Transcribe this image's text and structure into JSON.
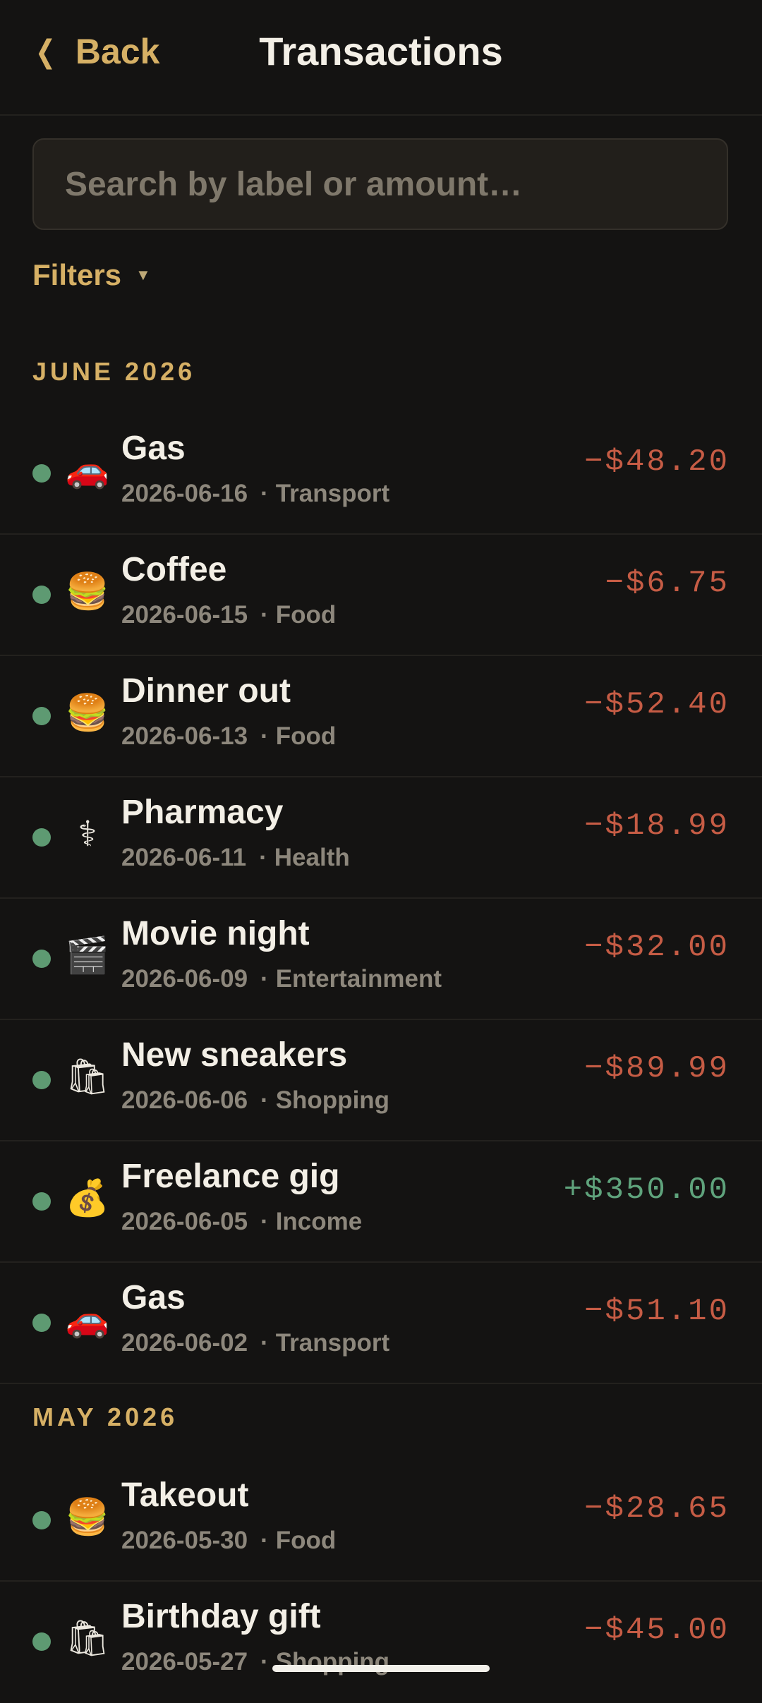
{
  "header": {
    "back_label": "Back",
    "title": "Transactions"
  },
  "search": {
    "placeholder": "Search by label or amount…",
    "value": ""
  },
  "filters": {
    "label": "Filters"
  },
  "colors": {
    "accent": "#d6b065",
    "negative": "#c65c45",
    "positive": "#5fa37c",
    "status_dot": "#5e9a72"
  },
  "sections": [
    {
      "label": "JUNE 2026",
      "transactions": [
        {
          "icon": "🚗",
          "icon_name": "car-icon",
          "label": "Gas",
          "date": "2026-06-16",
          "category": "Transport",
          "amount": "−$48.20",
          "type": "neg"
        },
        {
          "icon": "🍔",
          "icon_name": "burger-icon",
          "label": "Coffee",
          "date": "2026-06-15",
          "category": "Food",
          "amount": "−$6.75",
          "type": "neg"
        },
        {
          "icon": "🍔",
          "icon_name": "burger-icon",
          "label": "Dinner out",
          "date": "2026-06-13",
          "category": "Food",
          "amount": "−$52.40",
          "type": "neg"
        },
        {
          "icon": "⚕",
          "icon_name": "medical-icon",
          "label": "Pharmacy",
          "date": "2026-06-11",
          "category": "Health",
          "amount": "−$18.99",
          "type": "neg"
        },
        {
          "icon": "🎬",
          "icon_name": "clapperboard-icon",
          "label": "Movie night",
          "date": "2026-06-09",
          "category": "Entertainment",
          "amount": "−$32.00",
          "type": "neg"
        },
        {
          "icon": "🛍",
          "icon_name": "shopping-bags-icon",
          "label": "New sneakers",
          "date": "2026-06-06",
          "category": "Shopping",
          "amount": "−$89.99",
          "type": "neg"
        },
        {
          "icon": "💰",
          "icon_name": "money-bag-icon",
          "label": "Freelance gig",
          "date": "2026-06-05",
          "category": "Income",
          "amount": "+$350.00",
          "type": "pos"
        },
        {
          "icon": "🚗",
          "icon_name": "car-icon",
          "label": "Gas",
          "date": "2026-06-02",
          "category": "Transport",
          "amount": "−$51.10",
          "type": "neg"
        }
      ]
    },
    {
      "label": "MAY 2026",
      "transactions": [
        {
          "icon": "🍔",
          "icon_name": "burger-icon",
          "label": "Takeout",
          "date": "2026-05-30",
          "category": "Food",
          "amount": "−$28.65",
          "type": "neg"
        },
        {
          "icon": "🛍",
          "icon_name": "shopping-bags-icon",
          "label": "Birthday gift",
          "date": "2026-05-27",
          "category": "Shopping",
          "amount": "−$45.00",
          "type": "neg"
        }
      ]
    }
  ]
}
